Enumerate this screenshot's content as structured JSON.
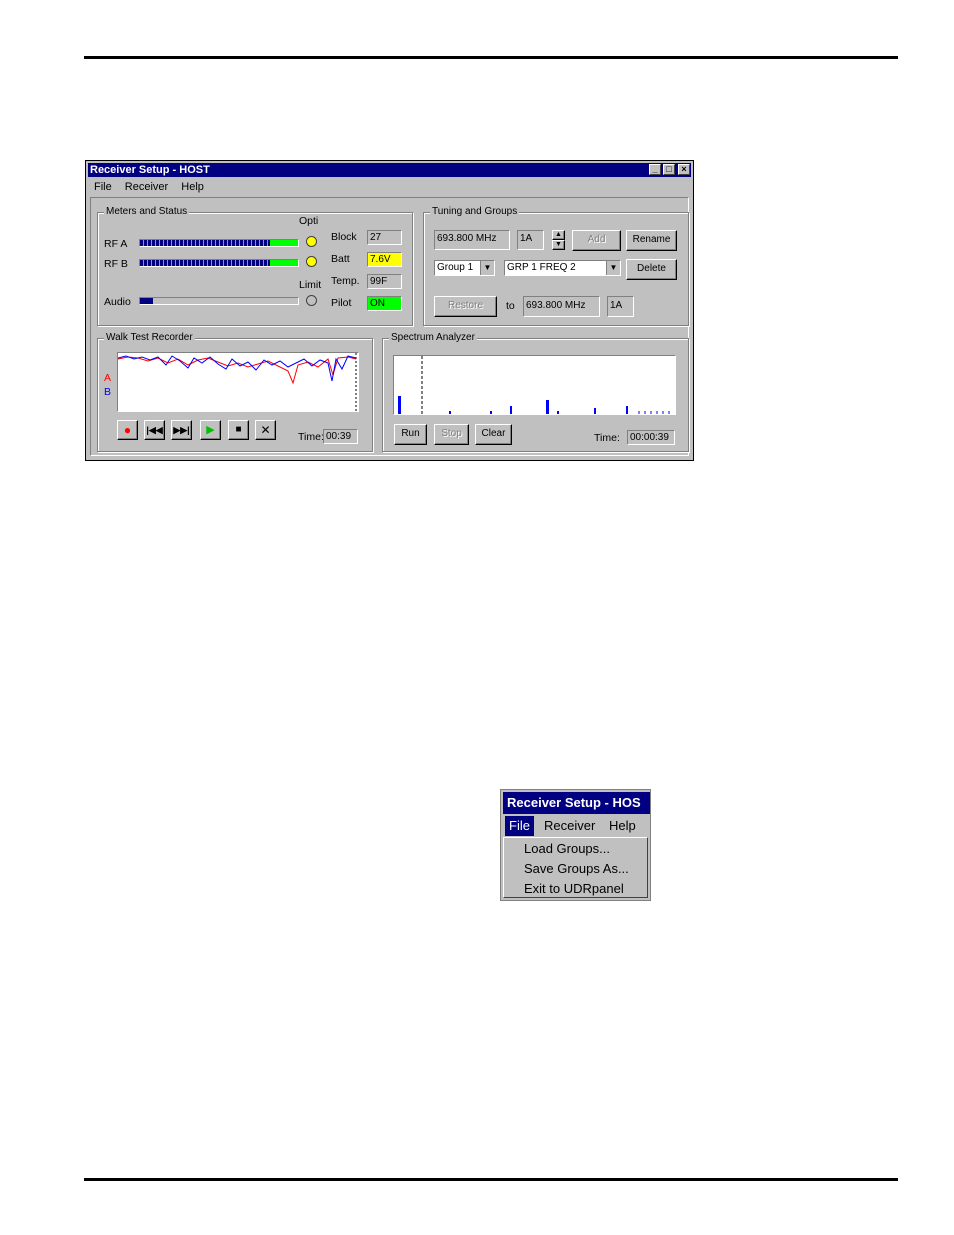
{
  "window": {
    "title": "Receiver Setup - HOST",
    "menu": [
      "File",
      "Receiver",
      "Help"
    ],
    "controls": [
      "_",
      "□",
      "×"
    ]
  },
  "meters": {
    "group_label": "Meters and Status",
    "opti_label": "Opti",
    "limit_label": "Limit",
    "rfa_label": "RF A",
    "rfb_label": "RF B",
    "audio_label": "Audio",
    "rfa_level": 0.82,
    "rfb_level": 0.82,
    "audio_level": 0.08,
    "status": {
      "block_label": "Block",
      "block_value": "27",
      "batt_label": "Batt",
      "batt_value": "7.6V",
      "temp_label": "Temp.",
      "temp_value": "99F",
      "pilot_label": "Pilot",
      "pilot_value": "ON"
    },
    "colors": {
      "meter_fill": "#00ff00",
      "led_on": "#ffff00",
      "batt_bg": "#ffff00",
      "pilot_bg": "#00ff00"
    }
  },
  "tuning": {
    "group_label": "Tuning and Groups",
    "frequency": "693.800 MHz",
    "channel": "1A",
    "add_button": "Add",
    "rename_button": "Rename",
    "group_select": "Group 1",
    "freq_select": "GRP 1 FREQ 2",
    "delete_button": "Delete",
    "restore_button": "Restore",
    "to_label": "to",
    "restore_freq": "693.800 MHz",
    "restore_channel": "1A"
  },
  "walk_test": {
    "group_label": "Walk Test Recorder",
    "legend_a": "A",
    "legend_b": "B",
    "time_label": "Time:",
    "time_value": "00:39",
    "colors": {
      "a": "#ff0000",
      "b": "#0000ff"
    }
  },
  "spectrum": {
    "group_label": "Spectrum Analyzer",
    "run_button": "Run",
    "stop_button": "Stop",
    "clear_button": "Clear",
    "time_label": "Time:",
    "time_value": "00:00:39"
  },
  "file_menu_window": {
    "title": "Receiver Setup - HOS",
    "menu": [
      "File",
      "Receiver",
      "Help"
    ],
    "items": [
      "Load Groups...",
      "Save Groups As...",
      "Exit to UDRpanel"
    ]
  }
}
